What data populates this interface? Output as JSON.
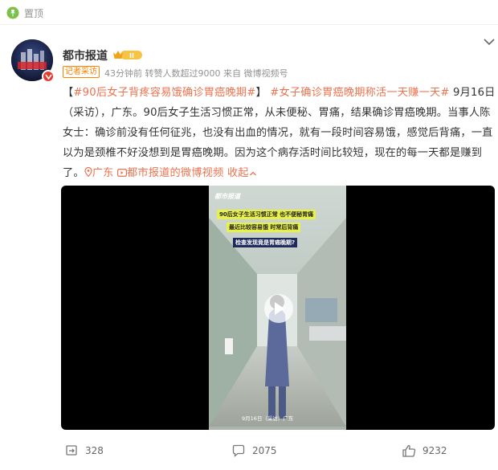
{
  "pinned": {
    "label": "置顶"
  },
  "author": {
    "name": "都市报道",
    "avatar_text": "都市报道",
    "badge_text": "II"
  },
  "meta": {
    "tag": "记者采访",
    "time": "43分钟前",
    "reposts_note": "转赞人数超过9000",
    "source": "来自 微博视频号"
  },
  "post": {
    "topic1": "#90后女子背疼容易饿确诊胃癌晚期#",
    "topic2": "#女子确诊胃癌晚期称活一天赚一天#",
    "body": "9月16日（采访），广东。90后女子生活习惯正常，从未便秘、胃痛，结果确诊胃癌晚期。当事人陈女士：确诊前没有任何征兆，也没有出血的情况，就有一段时间容易饿，感觉后背痛，一直以为是颈椎不好没想到是胃癌晚期。因为这个病存活时间比较短，现在的每一天都是赚到了。",
    "location": "广东",
    "video_link": "都市报道的微博视频",
    "collapse": "收起"
  },
  "video": {
    "watermark": "都市报道",
    "caption1": "90后女子生活习惯正常 也不便秘胃痛",
    "caption2": "最近比较容易饿 时常后背痛",
    "caption3": "检查发现竟是胃癌晚期?",
    "footer": "9月16日（采访）广东"
  },
  "actions": {
    "repost_count": "328",
    "comment_count": "2075",
    "like_count": "9232"
  },
  "colors": {
    "accent": "#eb7350",
    "tag": "#ff8200",
    "muted": "#939393"
  }
}
